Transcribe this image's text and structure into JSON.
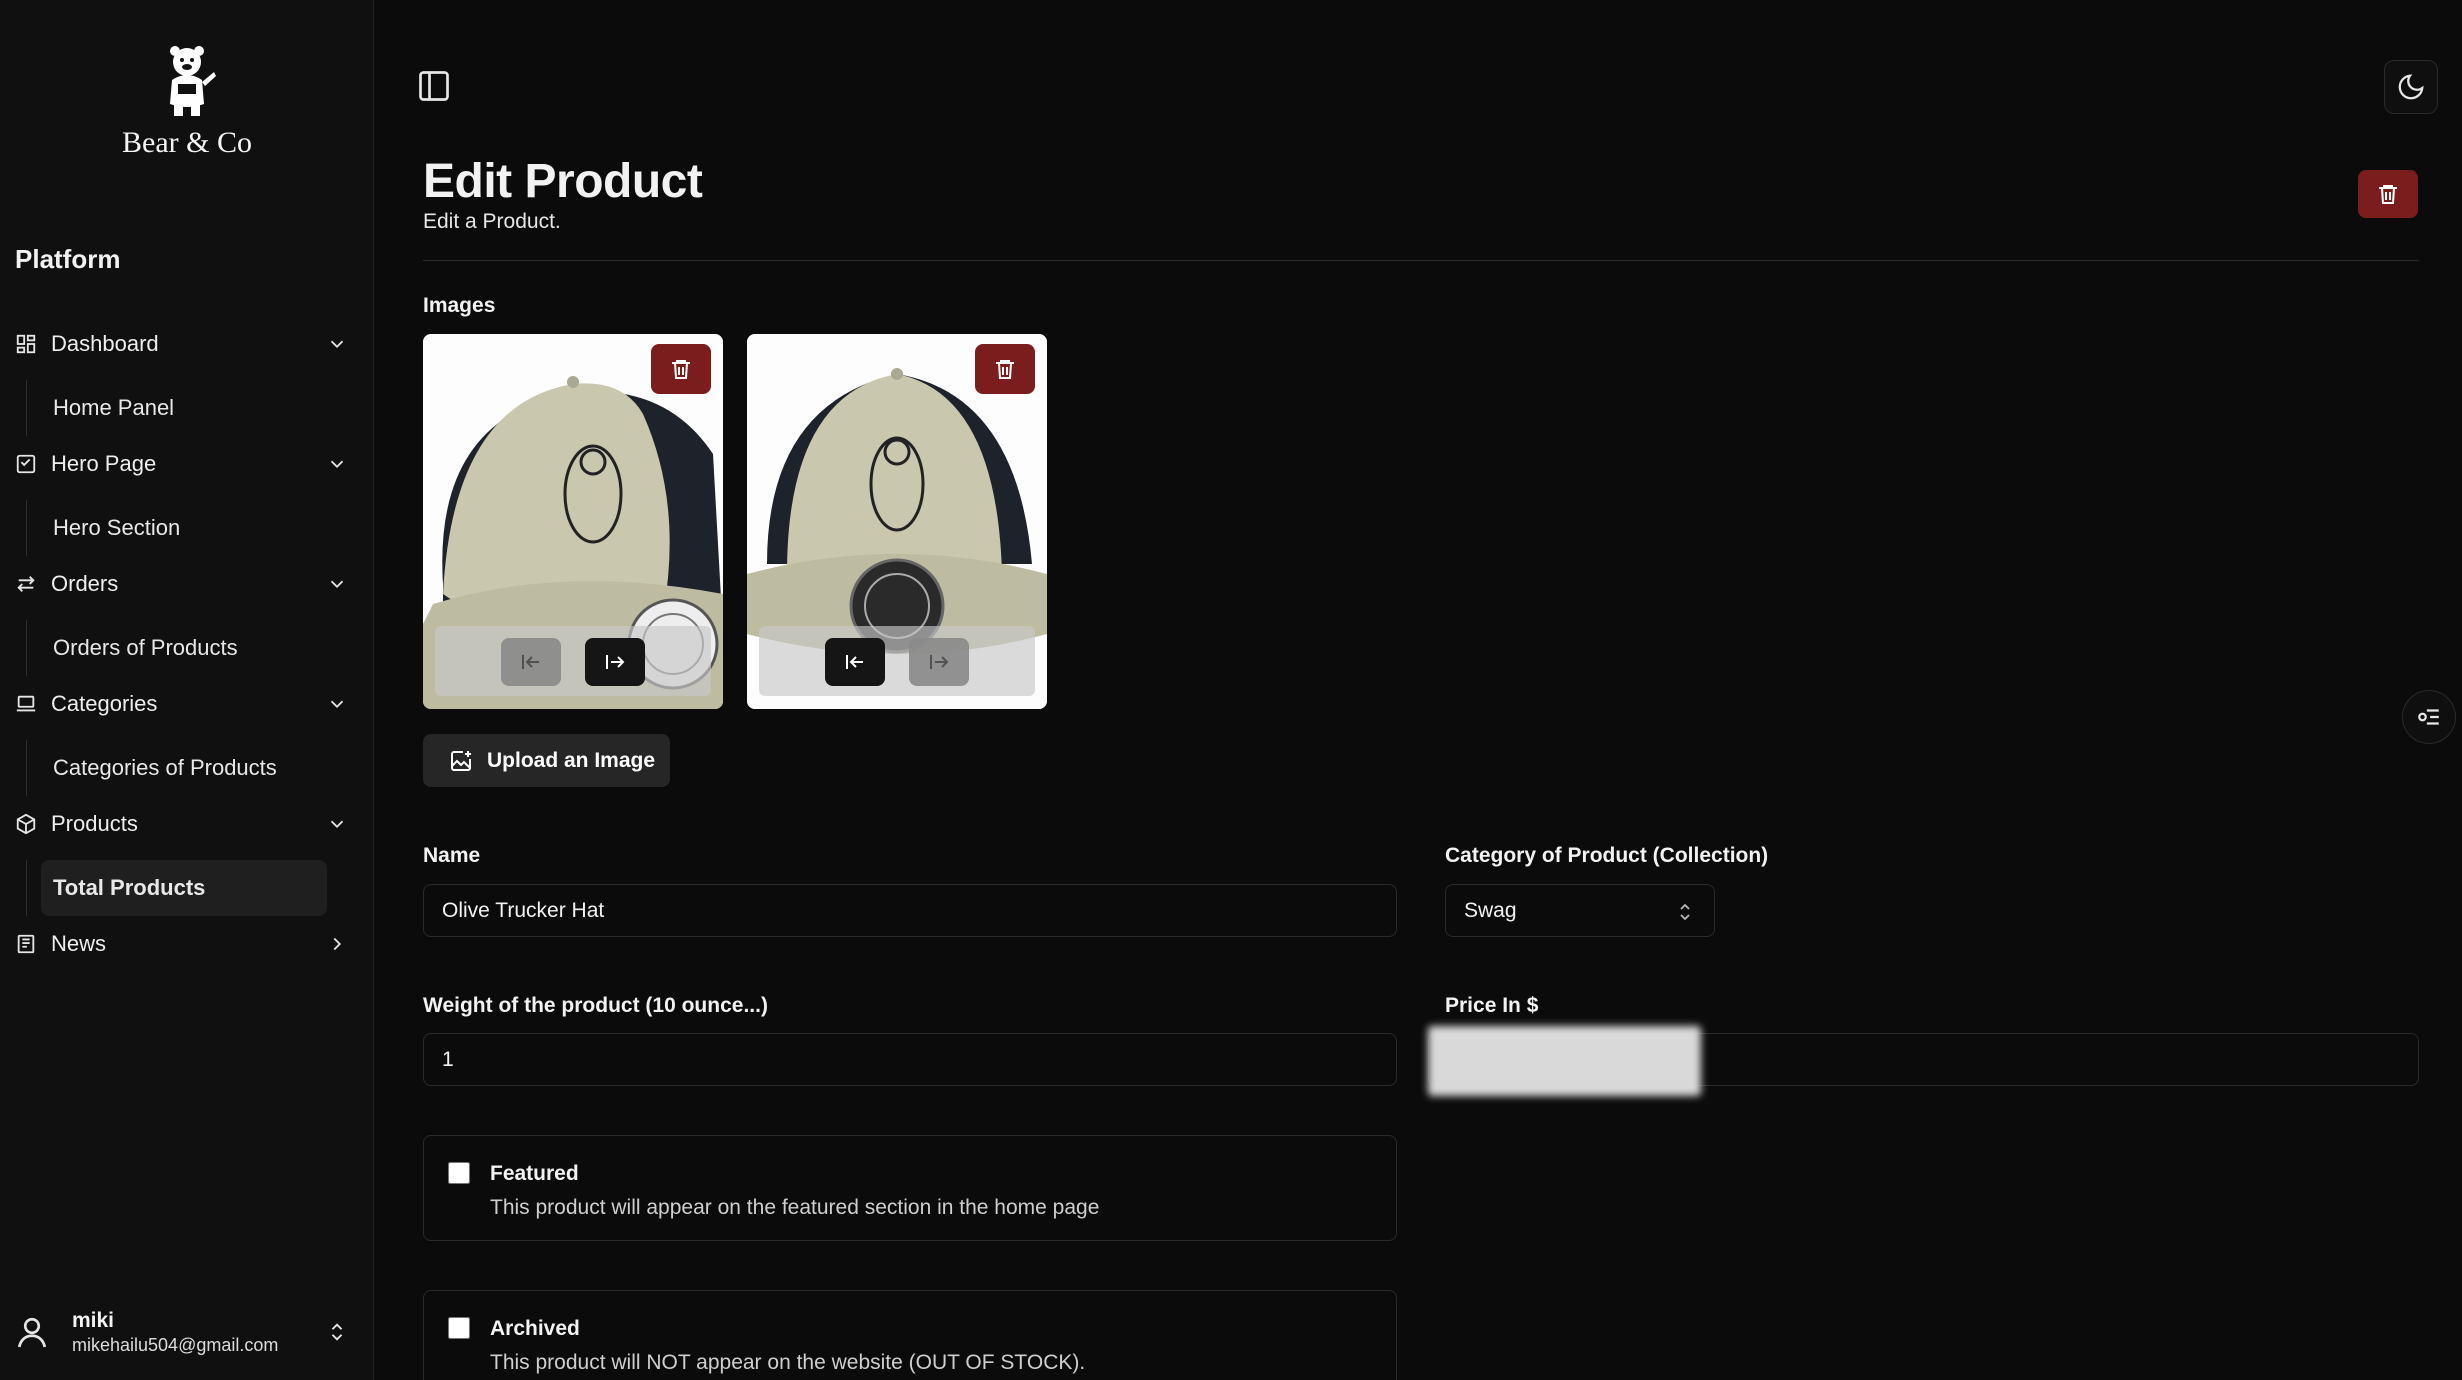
{
  "brand": {
    "name": "Bear & Co"
  },
  "sidebar": {
    "section_label": "Platform",
    "groups": [
      {
        "label": "Dashboard",
        "icon": "dashboard-icon",
        "sub": "Home Panel",
        "expanded": true
      },
      {
        "label": "Hero Page",
        "icon": "hero-icon",
        "sub": "Hero Section",
        "expanded": true
      },
      {
        "label": "Orders",
        "icon": "arrows-icon",
        "sub": "Orders of Products",
        "expanded": true
      },
      {
        "label": "Categories",
        "icon": "laptop-icon",
        "sub": "Categories of Products",
        "expanded": true
      },
      {
        "label": "Products",
        "icon": "box-icon",
        "sub": "Total Products",
        "expanded": true,
        "active_sub": true
      },
      {
        "label": "News",
        "icon": "newspaper-icon",
        "expanded": false
      }
    ],
    "user": {
      "name": "miki",
      "email": "mikehailu504@gmail.com"
    }
  },
  "page": {
    "title": "Edit Product",
    "subtitle": "Edit a Product."
  },
  "images_section": {
    "label": "Images",
    "upload_label": "Upload an Image",
    "cards": [
      {
        "alt": "Olive trucker hat front-left view",
        "left_enabled": false,
        "right_enabled": true
      },
      {
        "alt": "Olive trucker hat front view",
        "left_enabled": true,
        "right_enabled": false
      }
    ]
  },
  "form": {
    "name_label": "Name",
    "name_value": "Olive Trucker Hat",
    "category_label": "Category of Product (Collection)",
    "category_value": "Swag",
    "weight_label": "Weight of the product (10 ounce...)",
    "weight_value": "1",
    "price_label": "Price In $",
    "featured": {
      "title": "Featured",
      "description": "This product will appear on the featured section in the home page",
      "checked": false
    },
    "archived": {
      "title": "Archived",
      "description": "This product will NOT appear on the website (OUT OF STOCK).",
      "checked": false
    }
  },
  "colors": {
    "background": "#0b0b0b",
    "sidebar": "#101010",
    "danger": "#7c1d1d",
    "border": "#2a2a2a"
  }
}
